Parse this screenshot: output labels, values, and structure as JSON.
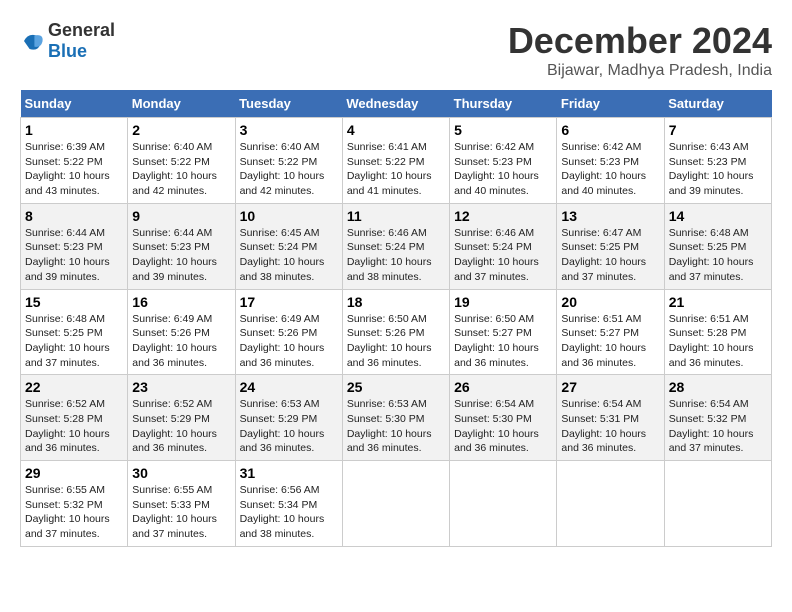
{
  "logo": {
    "general": "General",
    "blue": "Blue"
  },
  "title": "December 2024",
  "subtitle": "Bijawar, Madhya Pradesh, India",
  "days_of_week": [
    "Sunday",
    "Monday",
    "Tuesday",
    "Wednesday",
    "Thursday",
    "Friday",
    "Saturday"
  ],
  "weeks": [
    [
      {
        "day": "1",
        "sunrise": "Sunrise: 6:39 AM",
        "sunset": "Sunset: 5:22 PM",
        "daylight": "Daylight: 10 hours and 43 minutes."
      },
      {
        "day": "2",
        "sunrise": "Sunrise: 6:40 AM",
        "sunset": "Sunset: 5:22 PM",
        "daylight": "Daylight: 10 hours and 42 minutes."
      },
      {
        "day": "3",
        "sunrise": "Sunrise: 6:40 AM",
        "sunset": "Sunset: 5:22 PM",
        "daylight": "Daylight: 10 hours and 42 minutes."
      },
      {
        "day": "4",
        "sunrise": "Sunrise: 6:41 AM",
        "sunset": "Sunset: 5:22 PM",
        "daylight": "Daylight: 10 hours and 41 minutes."
      },
      {
        "day": "5",
        "sunrise": "Sunrise: 6:42 AM",
        "sunset": "Sunset: 5:23 PM",
        "daylight": "Daylight: 10 hours and 40 minutes."
      },
      {
        "day": "6",
        "sunrise": "Sunrise: 6:42 AM",
        "sunset": "Sunset: 5:23 PM",
        "daylight": "Daylight: 10 hours and 40 minutes."
      },
      {
        "day": "7",
        "sunrise": "Sunrise: 6:43 AM",
        "sunset": "Sunset: 5:23 PM",
        "daylight": "Daylight: 10 hours and 39 minutes."
      }
    ],
    [
      {
        "day": "8",
        "sunrise": "Sunrise: 6:44 AM",
        "sunset": "Sunset: 5:23 PM",
        "daylight": "Daylight: 10 hours and 39 minutes."
      },
      {
        "day": "9",
        "sunrise": "Sunrise: 6:44 AM",
        "sunset": "Sunset: 5:23 PM",
        "daylight": "Daylight: 10 hours and 39 minutes."
      },
      {
        "day": "10",
        "sunrise": "Sunrise: 6:45 AM",
        "sunset": "Sunset: 5:24 PM",
        "daylight": "Daylight: 10 hours and 38 minutes."
      },
      {
        "day": "11",
        "sunrise": "Sunrise: 6:46 AM",
        "sunset": "Sunset: 5:24 PM",
        "daylight": "Daylight: 10 hours and 38 minutes."
      },
      {
        "day": "12",
        "sunrise": "Sunrise: 6:46 AM",
        "sunset": "Sunset: 5:24 PM",
        "daylight": "Daylight: 10 hours and 37 minutes."
      },
      {
        "day": "13",
        "sunrise": "Sunrise: 6:47 AM",
        "sunset": "Sunset: 5:25 PM",
        "daylight": "Daylight: 10 hours and 37 minutes."
      },
      {
        "day": "14",
        "sunrise": "Sunrise: 6:48 AM",
        "sunset": "Sunset: 5:25 PM",
        "daylight": "Daylight: 10 hours and 37 minutes."
      }
    ],
    [
      {
        "day": "15",
        "sunrise": "Sunrise: 6:48 AM",
        "sunset": "Sunset: 5:25 PM",
        "daylight": "Daylight: 10 hours and 37 minutes."
      },
      {
        "day": "16",
        "sunrise": "Sunrise: 6:49 AM",
        "sunset": "Sunset: 5:26 PM",
        "daylight": "Daylight: 10 hours and 36 minutes."
      },
      {
        "day": "17",
        "sunrise": "Sunrise: 6:49 AM",
        "sunset": "Sunset: 5:26 PM",
        "daylight": "Daylight: 10 hours and 36 minutes."
      },
      {
        "day": "18",
        "sunrise": "Sunrise: 6:50 AM",
        "sunset": "Sunset: 5:26 PM",
        "daylight": "Daylight: 10 hours and 36 minutes."
      },
      {
        "day": "19",
        "sunrise": "Sunrise: 6:50 AM",
        "sunset": "Sunset: 5:27 PM",
        "daylight": "Daylight: 10 hours and 36 minutes."
      },
      {
        "day": "20",
        "sunrise": "Sunrise: 6:51 AM",
        "sunset": "Sunset: 5:27 PM",
        "daylight": "Daylight: 10 hours and 36 minutes."
      },
      {
        "day": "21",
        "sunrise": "Sunrise: 6:51 AM",
        "sunset": "Sunset: 5:28 PM",
        "daylight": "Daylight: 10 hours and 36 minutes."
      }
    ],
    [
      {
        "day": "22",
        "sunrise": "Sunrise: 6:52 AM",
        "sunset": "Sunset: 5:28 PM",
        "daylight": "Daylight: 10 hours and 36 minutes."
      },
      {
        "day": "23",
        "sunrise": "Sunrise: 6:52 AM",
        "sunset": "Sunset: 5:29 PM",
        "daylight": "Daylight: 10 hours and 36 minutes."
      },
      {
        "day": "24",
        "sunrise": "Sunrise: 6:53 AM",
        "sunset": "Sunset: 5:29 PM",
        "daylight": "Daylight: 10 hours and 36 minutes."
      },
      {
        "day": "25",
        "sunrise": "Sunrise: 6:53 AM",
        "sunset": "Sunset: 5:30 PM",
        "daylight": "Daylight: 10 hours and 36 minutes."
      },
      {
        "day": "26",
        "sunrise": "Sunrise: 6:54 AM",
        "sunset": "Sunset: 5:30 PM",
        "daylight": "Daylight: 10 hours and 36 minutes."
      },
      {
        "day": "27",
        "sunrise": "Sunrise: 6:54 AM",
        "sunset": "Sunset: 5:31 PM",
        "daylight": "Daylight: 10 hours and 36 minutes."
      },
      {
        "day": "28",
        "sunrise": "Sunrise: 6:54 AM",
        "sunset": "Sunset: 5:32 PM",
        "daylight": "Daylight: 10 hours and 37 minutes."
      }
    ],
    [
      {
        "day": "29",
        "sunrise": "Sunrise: 6:55 AM",
        "sunset": "Sunset: 5:32 PM",
        "daylight": "Daylight: 10 hours and 37 minutes."
      },
      {
        "day": "30",
        "sunrise": "Sunrise: 6:55 AM",
        "sunset": "Sunset: 5:33 PM",
        "daylight": "Daylight: 10 hours and 37 minutes."
      },
      {
        "day": "31",
        "sunrise": "Sunrise: 6:56 AM",
        "sunset": "Sunset: 5:34 PM",
        "daylight": "Daylight: 10 hours and 38 minutes."
      },
      null,
      null,
      null,
      null
    ]
  ]
}
